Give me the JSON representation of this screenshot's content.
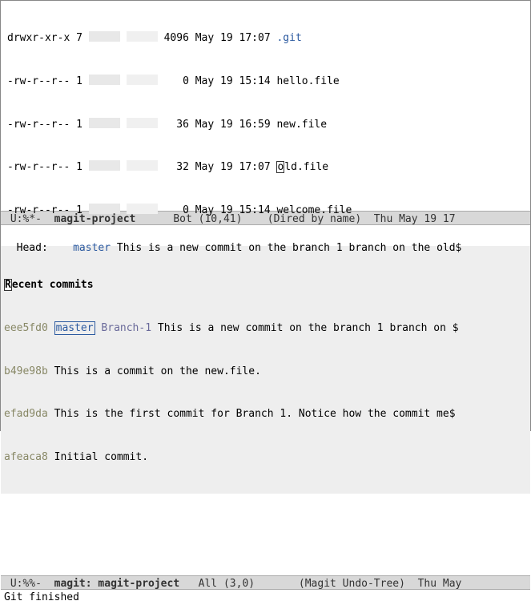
{
  "dired": {
    "entries": [
      {
        "perms": "drwxr-xr-x",
        "links": "7",
        "size": "4096",
        "date": "May 19 17:07",
        "name": ".git",
        "is_dir": true,
        "cursor": ""
      },
      {
        "perms": "-rw-r--r--",
        "links": "1",
        "size": "0",
        "date": "May 19 15:14",
        "name": "hello.file",
        "is_dir": false,
        "cursor": ""
      },
      {
        "perms": "-rw-r--r--",
        "links": "1",
        "size": "36",
        "date": "May 19 16:59",
        "name": "new.file",
        "is_dir": false,
        "cursor": ""
      },
      {
        "perms": "-rw-r--r--",
        "links": "1",
        "size": "32",
        "date": "May 19 17:07",
        "name": "ld.file",
        "is_dir": false,
        "cursor": "o"
      },
      {
        "perms": "-rw-r--r--",
        "links": "1",
        "size": "0",
        "date": "May 19 15:14",
        "name": "welcome.file",
        "is_dir": false,
        "cursor": ""
      }
    ]
  },
  "modeline1": {
    "status": " U:%*-  ",
    "buffer": "magit-project",
    "pos": "      Bot (10,41)    ",
    "mode": "(Dired by name)  Thu May 19 17"
  },
  "magit": {
    "head_label": "Head:    ",
    "head_branch": "master",
    "head_msg": " This is a new commit on the branch 1 branch on the old$",
    "section_title_first_char": "R",
    "section_title_rest": "ecent commits",
    "commits": [
      {
        "hash": "eee5fd0",
        "branch1": "master",
        "branch2": "Branch-1",
        "msg": " This is a new commit on the branch 1 branch on $"
      },
      {
        "hash": "b49e98b",
        "branch1": "",
        "branch2": "",
        "msg": "This is a commit on the new.file."
      },
      {
        "hash": "efad9da",
        "branch1": "",
        "branch2": "",
        "msg": "This is the first commit for Branch 1. Notice how the commit me$"
      },
      {
        "hash": "afeaca8",
        "branch1": "",
        "branch2": "",
        "msg": "Initial commit."
      }
    ]
  },
  "modeline2": {
    "status": " U:%%-  ",
    "buffer": "magit: magit-project",
    "pos": "   All (3,0)       ",
    "mode": "(Magit Undo-Tree)  Thu May "
  },
  "echo": "Git finished"
}
